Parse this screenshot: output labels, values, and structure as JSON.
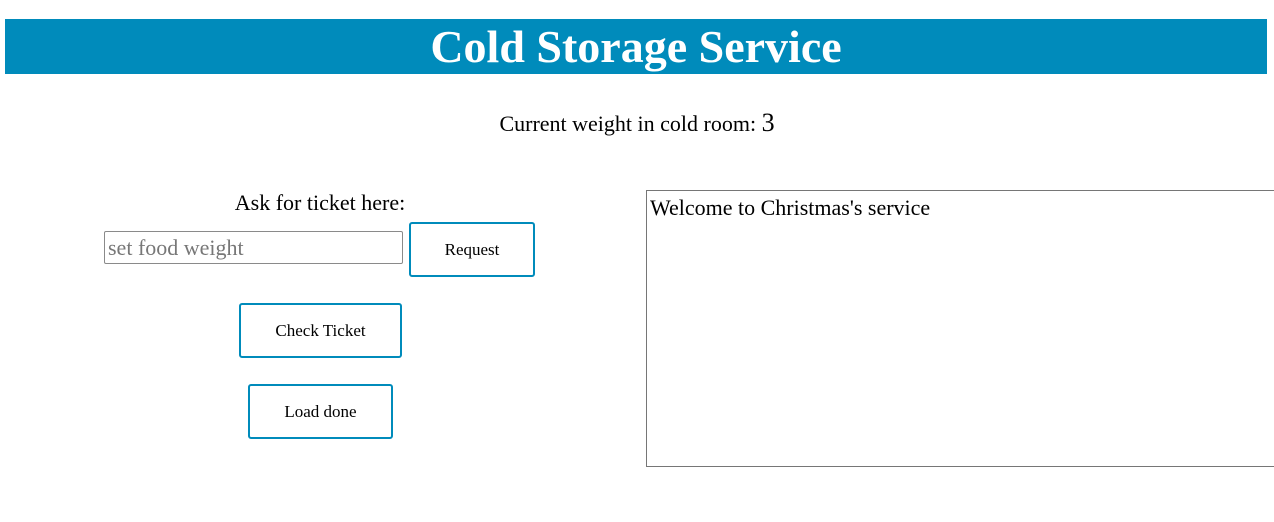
{
  "header": {
    "title": "Cold Storage Service",
    "background_color": "#008bbb"
  },
  "status": {
    "weight_label": "Current weight in cold room:",
    "weight_value": "3"
  },
  "ticket": {
    "ask_label": "Ask for ticket here:",
    "food_weight_placeholder": "set food weight",
    "food_weight_value": "",
    "request_label": "Request",
    "check_ticket_label": "Check Ticket",
    "load_done_label": "Load done"
  },
  "log": {
    "message": "Welcome to Christmas's service"
  }
}
